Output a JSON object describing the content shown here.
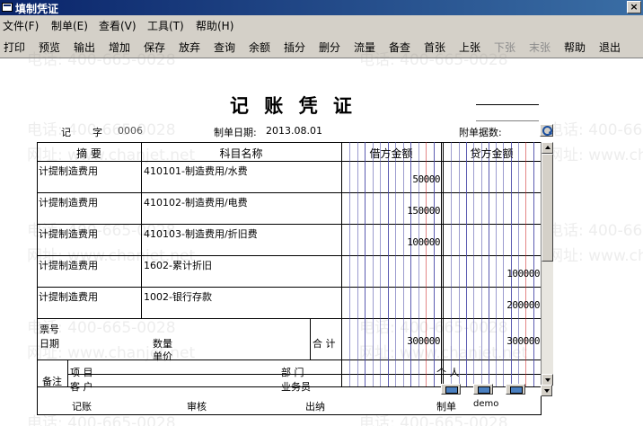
{
  "window": {
    "title": "填制凭证",
    "close_label": "×"
  },
  "menu": [
    "文件(F)",
    "制单(E)",
    "查看(V)",
    "工具(T)",
    "帮助(H)"
  ],
  "toolbar": {
    "buttons": [
      "打印",
      "预览",
      "输出",
      "增加",
      "保存",
      "放弃",
      "查询",
      "余额",
      "插分",
      "删分",
      "流量",
      "备查",
      "首张",
      "上张",
      "下张",
      "末张",
      "帮助",
      "退出"
    ],
    "disabled": [
      "下张",
      "末张"
    ]
  },
  "voucher": {
    "title": "记 账 凭 证",
    "type_label": "记",
    "number_label": "字",
    "number": "0006",
    "date_label": "制单日期:",
    "date": "2013.08.01",
    "attachments_label": "附单据数:",
    "headers": {
      "summary": "摘 要",
      "account": "科目名称",
      "debit": "借方金额",
      "credit": "贷方金额"
    },
    "rows": [
      {
        "summary": "计提制造费用",
        "account": "410101-制造费用/水费",
        "debit": "50000",
        "credit": ""
      },
      {
        "summary": "计提制造费用",
        "account": "410102-制造费用/电费",
        "debit": "150000",
        "credit": ""
      },
      {
        "summary": "计提制造费用",
        "account": "410103-制造费用/折旧费",
        "debit": "100000",
        "credit": ""
      },
      {
        "summary": "计提制造费用",
        "account": "1602-累计折旧",
        "debit": "",
        "credit": "100000"
      },
      {
        "summary": "计提制造费用",
        "account": "1002-银行存款",
        "debit": "",
        "credit": "200000"
      }
    ],
    "bill_no_label": "票号",
    "date_field_label": "日期",
    "qty_label": "数量",
    "price_label": "单价",
    "total_label": "合 计",
    "total_debit": "300000",
    "total_credit": "300000",
    "remarks_label": "备注",
    "project_label": "项 目",
    "department_label": "部 门",
    "person_label": "个 人",
    "customer_label": "客 户",
    "salesman_label": "业务员",
    "bookkeeping_label": "记账",
    "audit_label": "审核",
    "cashier_label": "出纳",
    "maker_label": "制单",
    "maker": "demo"
  },
  "watermark": {
    "phone": "电话: 400-665-0028",
    "site": "网址: www.chanjet.net"
  },
  "colors": {
    "titlebar": "#0a246a",
    "digit_line_blue": "#4a4aa8",
    "digit_line_red": "#cc2222",
    "chrome": "#d4d0c8"
  }
}
